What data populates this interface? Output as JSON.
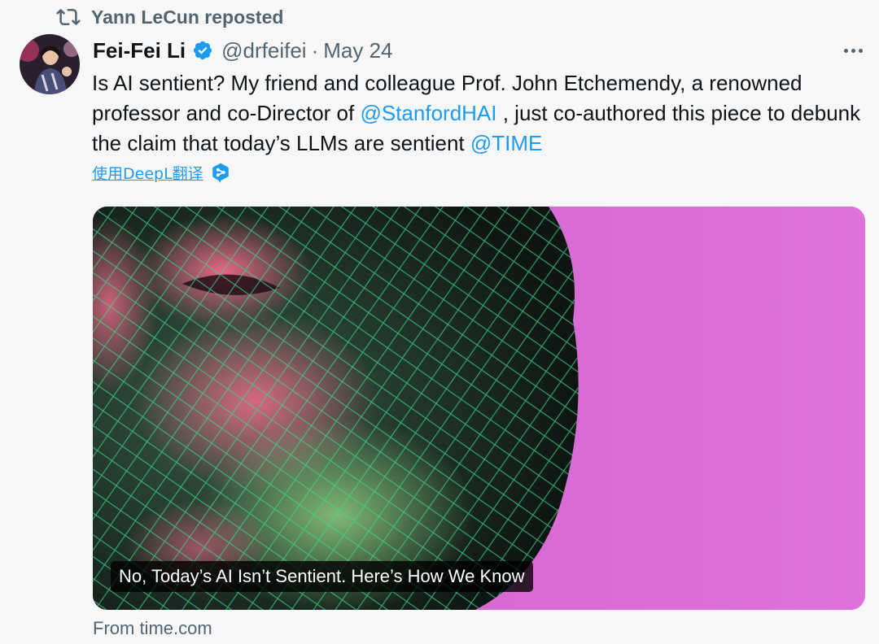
{
  "repost": {
    "label": "Yann LeCun reposted",
    "icon": "repost-icon"
  },
  "author": {
    "display_name": "Fei-Fei Li",
    "handle": "@drfeifei",
    "separator": "·",
    "date": "May 24",
    "verified": true
  },
  "tweet": {
    "text_part1": "Is AI sentient? My friend and colleague Prof. John Etchemendy, a renowned professor and co-Director of ",
    "mention1": "@StanfordHAI",
    "text_part2": " , just co-authored this piece to debunk the claim that today’s LLMs are sentient ",
    "mention2": "@TIME"
  },
  "translate": {
    "label": "使用DeepL翻译"
  },
  "card": {
    "headline": "No, Today’s AI Isn’t Sentient. Here’s How We Know",
    "source": "From time.com"
  },
  "colors": {
    "link": "#1d9bf0",
    "secondary_text": "#536471",
    "background": "#f7f7f7",
    "card_magenta": "#d768d2"
  }
}
